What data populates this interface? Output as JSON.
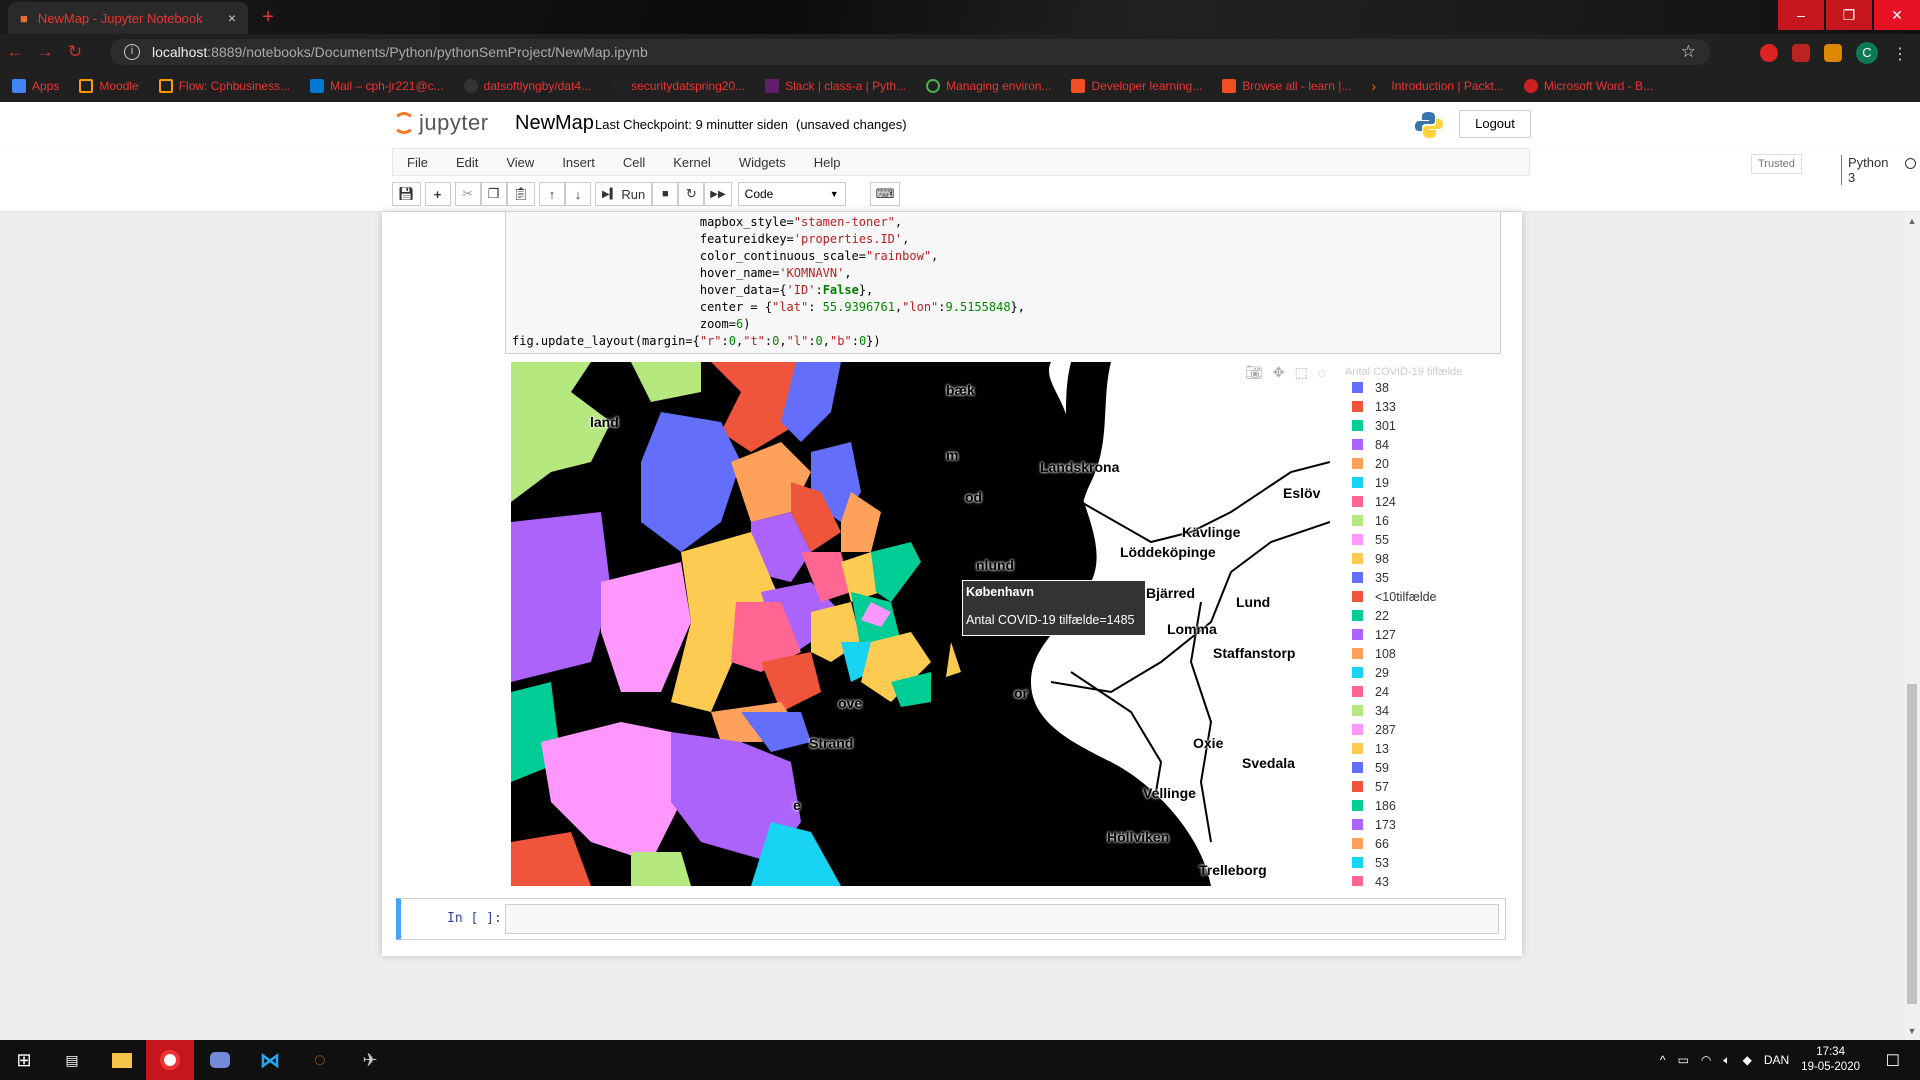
{
  "browser": {
    "tab_title": "NewMap - Jupyter Notebook",
    "tab_close": "×",
    "new_tab": "+",
    "url_host": "localhost",
    "url_path": ":8889/notebooks/Documents/Python/pythonSemProject/NewMap.ipynb",
    "avatar_letter": "C",
    "bookmarks": [
      "Apps",
      "Moodle",
      "Flow: Cphbusiness...",
      "Mail – cph-jr221@c...",
      "datsoftlyngby/dat4...",
      "securitydatspring20...",
      "Slack | class-a | Pyth...",
      "Managing environ...",
      "Developer learning...",
      "Browse all - learn |...",
      "Introduction | Packt...",
      "Microsoft Word - B..."
    ]
  },
  "jupyter": {
    "logo_text": "jupyter",
    "notebook_title": "NewMap",
    "checkpoint": "Last Checkpoint: 9 minutter siden",
    "autosave": "(unsaved changes)",
    "logout": "Logout",
    "menu": [
      "File",
      "Edit",
      "View",
      "Insert",
      "Cell",
      "Kernel",
      "Widgets",
      "Help"
    ],
    "trusted": "Trusted",
    "kernel": "Python 3",
    "run_label": "Run",
    "cell_type": "Code"
  },
  "code_lines": [
    {
      "indent": "                          ",
      "parts": [
        [
          "",
          "mapbox_style="
        ],
        [
          "s",
          "\"stamen-toner\""
        ],
        [
          "",
          ","
        ]
      ]
    },
    {
      "indent": "                          ",
      "parts": [
        [
          "",
          "featureidkey="
        ],
        [
          "s",
          "'properties.ID'"
        ],
        [
          "",
          ","
        ]
      ]
    },
    {
      "indent": "                          ",
      "parts": [
        [
          "",
          "color_continuous_scale="
        ],
        [
          "s",
          "\"rainbow\""
        ],
        [
          "",
          ","
        ]
      ]
    },
    {
      "indent": "                          ",
      "parts": [
        [
          "",
          "hover_name="
        ],
        [
          "s",
          "'KOMNAVN'"
        ],
        [
          "",
          ","
        ]
      ]
    },
    {
      "indent": "                          ",
      "parts": [
        [
          "",
          "hover_data={"
        ],
        [
          "s",
          "'ID'"
        ],
        [
          "",
          ":"
        ],
        [
          "k",
          "False"
        ],
        [
          "",
          "},"
        ]
      ]
    },
    {
      "indent": "                          ",
      "parts": [
        [
          "",
          "center = {"
        ],
        [
          "s",
          "\"lat\""
        ],
        [
          "",
          ": "
        ],
        [
          "n",
          "55.9396761"
        ],
        [
          "",
          ","
        ],
        [
          "s",
          "\"lon\""
        ],
        [
          "",
          ":"
        ],
        [
          "n",
          "9.5155848"
        ],
        [
          "",
          "},"
        ]
      ]
    },
    {
      "indent": "                          ",
      "parts": [
        [
          "",
          "zoom="
        ],
        [
          "n",
          "6"
        ],
        [
          "",
          ")"
        ]
      ]
    },
    {
      "indent": "",
      "parts": [
        [
          "",
          "fig.update_layout(margin={"
        ],
        [
          "s",
          "\"r\""
        ],
        [
          "",
          ":"
        ],
        [
          "n",
          "0"
        ],
        [
          "",
          ","
        ],
        [
          "s",
          "\"t\""
        ],
        [
          "",
          ":"
        ],
        [
          "n",
          "0"
        ],
        [
          "",
          ","
        ],
        [
          "s",
          "\"l\""
        ],
        [
          "",
          ":"
        ],
        [
          "n",
          "0"
        ],
        [
          "",
          ","
        ],
        [
          "s",
          "\"b\""
        ],
        [
          "",
          ":"
        ],
        [
          "n",
          "0"
        ],
        [
          "",
          "})"
        ]
      ]
    }
  ],
  "map": {
    "place_labels": [
      "land",
      "bæk",
      "m",
      "Landskrona",
      "Eslöv",
      "od",
      "Kävlinge",
      "Löddeköpinge",
      "nlund",
      "Bjärred",
      "Lund",
      "Lomma",
      "Staffanstorp",
      "or",
      "ove",
      "Strand",
      "Oxie",
      "Svedala",
      "Vellinge",
      "Höllviken",
      "Trelleborg",
      "e"
    ],
    "hover_name": "København",
    "hover_value": "Antal COVID-19 tilfælde=1485",
    "legend_title": "Antal COVID-19 tilfælde"
  },
  "legend": [
    {
      "label": "38",
      "color": "#636efa"
    },
    {
      "label": "133",
      "color": "#ef553b"
    },
    {
      "label": "301",
      "color": "#00cc96"
    },
    {
      "label": "84",
      "color": "#ab63fa"
    },
    {
      "label": "20",
      "color": "#ffa15a"
    },
    {
      "label": "19",
      "color": "#19d3f3"
    },
    {
      "label": "124",
      "color": "#ff6692"
    },
    {
      "label": "16",
      "color": "#b6e880"
    },
    {
      "label": "55",
      "color": "#ff97ff"
    },
    {
      "label": "98",
      "color": "#fecb52"
    },
    {
      "label": "35",
      "color": "#636efa"
    },
    {
      "label": "<10tilfælde",
      "color": "#ef553b"
    },
    {
      "label": "22",
      "color": "#00cc96"
    },
    {
      "label": "127",
      "color": "#ab63fa"
    },
    {
      "label": "108",
      "color": "#ffa15a"
    },
    {
      "label": "29",
      "color": "#19d3f3"
    },
    {
      "label": "24",
      "color": "#ff6692"
    },
    {
      "label": "34",
      "color": "#b6e880"
    },
    {
      "label": "287",
      "color": "#ff97ff"
    },
    {
      "label": "13",
      "color": "#fecb52"
    },
    {
      "label": "59",
      "color": "#636efa"
    },
    {
      "label": "57",
      "color": "#ef553b"
    },
    {
      "label": "186",
      "color": "#00cc96"
    },
    {
      "label": "173",
      "color": "#ab63fa"
    },
    {
      "label": "66",
      "color": "#ffa15a"
    },
    {
      "label": "53",
      "color": "#19d3f3"
    },
    {
      "label": "43",
      "color": "#ff6692"
    }
  ],
  "cell": {
    "prompt": "In [ ]:"
  },
  "taskbar": {
    "time": "17:34",
    "date": "19-05-2020",
    "lang": "DAN"
  }
}
